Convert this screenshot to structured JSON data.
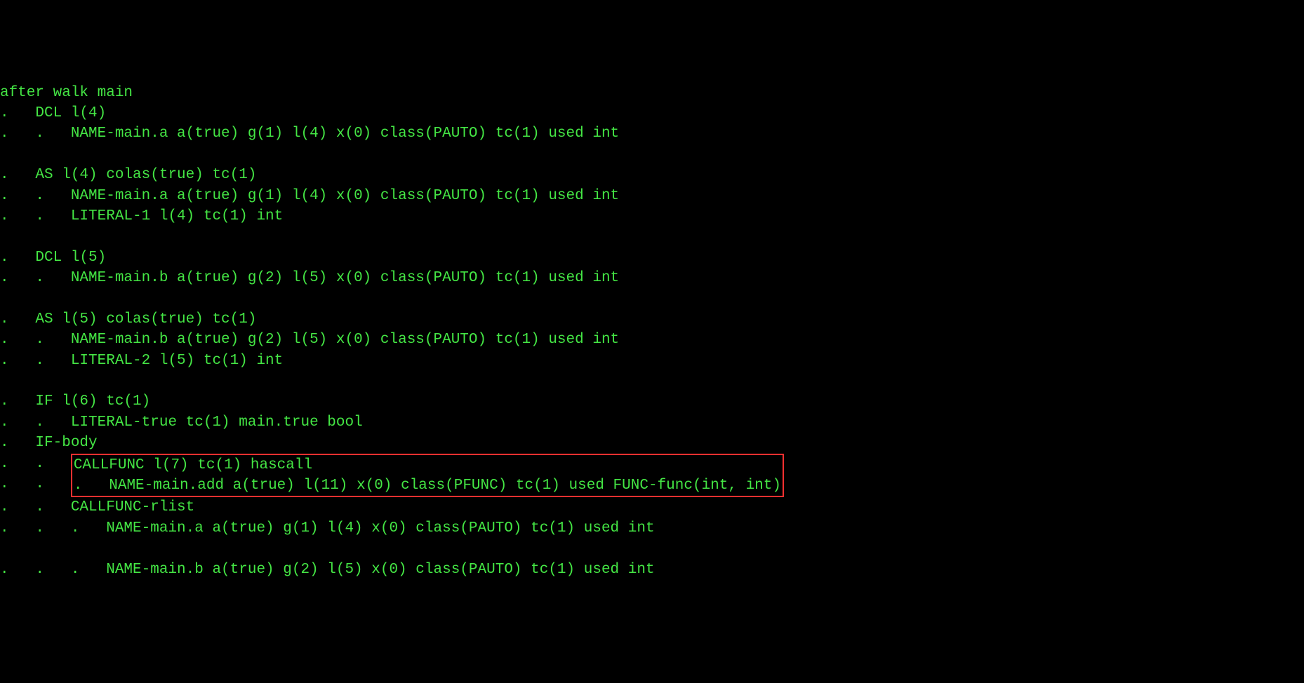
{
  "terminal": {
    "lines": [
      "after walk main",
      ".   DCL l(4)",
      ".   .   NAME-main.a a(true) g(1) l(4) x(0) class(PAUTO) tc(1) used int",
      "",
      ".   AS l(4) colas(true) tc(1)",
      ".   .   NAME-main.a a(true) g(1) l(4) x(0) class(PAUTO) tc(1) used int",
      ".   .   LITERAL-1 l(4) tc(1) int",
      "",
      ".   DCL l(5)",
      ".   .   NAME-main.b a(true) g(2) l(5) x(0) class(PAUTO) tc(1) used int",
      "",
      ".   AS l(5) colas(true) tc(1)",
      ".   .   NAME-main.b a(true) g(2) l(5) x(0) class(PAUTO) tc(1) used int",
      ".   .   LITERAL-2 l(5) tc(1) int",
      "",
      ".   IF l(6) tc(1)",
      ".   .   LITERAL-true tc(1) main.true bool",
      ".   IF-body"
    ],
    "highlight_prefix": ".   .   ",
    "highlight_lines": [
      "CALLFUNC l(7) tc(1) hascall                                                   ",
      ".   NAME-main.add a(true) l(11) x(0) class(PFUNC) tc(1) used FUNC-func(int, int)"
    ],
    "after_lines": [
      ".   .   CALLFUNC-rlist",
      ".   .   .   NAME-main.a a(true) g(1) l(4) x(0) class(PAUTO) tc(1) used int",
      "",
      ".   .   .   NAME-main.b a(true) g(2) l(5) x(0) class(PAUTO) tc(1) used int"
    ]
  }
}
